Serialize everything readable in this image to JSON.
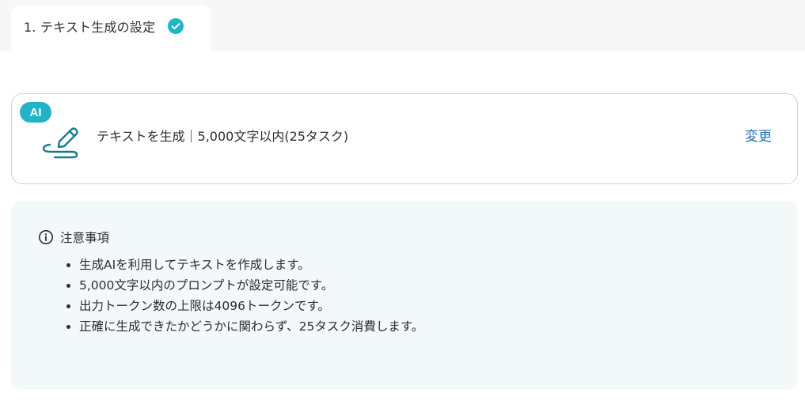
{
  "tab": {
    "label": "1. テキスト生成の設定",
    "status_icon": "check-circle-icon",
    "status_color": "#22b3c9"
  },
  "action": {
    "badge": "AI",
    "icon": "pen-icon",
    "summary": "テキストを生成｜5,000文字以内(25タスク)",
    "change_label": "変更",
    "accent_color": "#22b3c9",
    "link_color": "#1f6fb0"
  },
  "notice": {
    "icon": "info-icon",
    "title": "注意事項",
    "items": [
      "生成AIを利用してテキストを作成します。",
      "5,000文字以内のプロンプトが設定可能です。",
      "出力トークン数の上限は4096トークンです。",
      "正確に生成できたかどうかに関わらず、25タスク消費します。"
    ],
    "background": "#f2f9f8"
  }
}
